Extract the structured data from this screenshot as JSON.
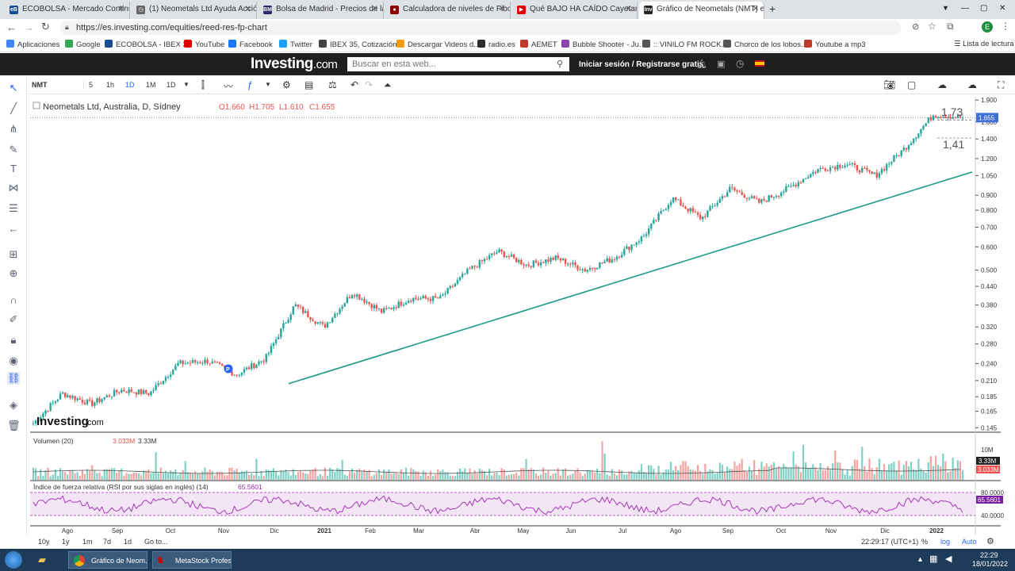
{
  "browser": {
    "tabs": [
      {
        "label": "ECOBOLSA - Mercado Continuo",
        "fav": "eB",
        "color": "#1a4d8f"
      },
      {
        "label": "(1) Neometals Ltd Ayuda Acción",
        "fav": "◷",
        "color": "#666666"
      },
      {
        "label": "Bolsa de Madrid - Precios de la s",
        "fav": "BM",
        "color": "#2a2a6a"
      },
      {
        "label": "Calculadora de niveles de Fibona",
        "fav": "●",
        "color": "#8b0000"
      },
      {
        "label": "Qué BAJO HA CAÍDO Cayetana c",
        "fav": "▶",
        "color": "#e00000"
      },
      {
        "label": "Gráfico de Neometals (NMT) en",
        "fav": "Inv",
        "color": "#222222"
      }
    ],
    "new_tab": "+",
    "url": "https://es.investing.com/equities/reed-res-fp-chart",
    "bookmarks": [
      {
        "label": "Aplicaciones",
        "color": "#4285f4"
      },
      {
        "label": "Google",
        "color": "#34a853"
      },
      {
        "label": "ECOBOLSA - IBEX 35",
        "color": "#1a4d8f"
      },
      {
        "label": "YouTube",
        "color": "#e00000"
      },
      {
        "label": "Facebook",
        "color": "#1877f2"
      },
      {
        "label": "Twitter",
        "color": "#1da1f2"
      },
      {
        "label": "IBEX 35, Cotización...",
        "color": "#444444"
      },
      {
        "label": "Descargar Videos d...",
        "color": "#f39c12"
      },
      {
        "label": "radio.es",
        "color": "#2d2d2d"
      },
      {
        "label": "AEMET",
        "color": "#c0392b"
      },
      {
        "label": "Bubble Shooter - Ju...",
        "color": "#8e44ad"
      },
      {
        "label": ":: VINILO FM ROCK...",
        "color": "#555555"
      },
      {
        "label": "Chorco de los lobos...",
        "color": "#555555"
      },
      {
        "label": "Youtube a mp3",
        "color": "#c0392b"
      }
    ],
    "reading_list": "Lista de lectura",
    "profile_initial": "E"
  },
  "site": {
    "logo": "Investing",
    "logo_suffix": ".com",
    "search_placeholder": "Buscar en esta web...",
    "login": "Iniciar sesión / Registrarse gratis"
  },
  "toolbar": {
    "symbol": "NMT",
    "intervals": [
      "5",
      "1h",
      "1D",
      "1M",
      "1D"
    ],
    "active_interval": "1D"
  },
  "legend": {
    "title": "Neometals Ltd, Australia, D, Sídney",
    "o": "O1.660",
    "h": "H1.705",
    "l": "L1.610",
    "c": "C1.655"
  },
  "volume_legend": {
    "title": "Volumen (20)",
    "v1": "3.033M",
    "v2": "3.33M"
  },
  "rsi_legend": {
    "title": "Índice de fuerza relativa (RSI por sus siglas en inglés) (14)",
    "value": "65.5601"
  },
  "watermark": {
    "logo": "Investing",
    "suffix": ".com"
  },
  "chart_data": {
    "type": "candlestick",
    "title": "Neometals Ltd, Australia, D, Sídney",
    "scale": "log",
    "ylim": [
      0.14,
      1.95
    ],
    "y_ticks": [
      "1.900",
      "1.600",
      "1.400",
      "1.200",
      "1.050",
      "0.900",
      "0.800",
      "0.700",
      "0.600",
      "0.500",
      "0.440",
      "0.380",
      "0.320",
      "0.280",
      "0.240",
      "0.210",
      "0.185",
      "0.165",
      "0.145"
    ],
    "x_ticks": [
      "Ago",
      "Sep",
      "Oct",
      "Nov",
      "Dic",
      "2021",
      "Feb",
      "Mar",
      "Abr",
      "May",
      "Jun",
      "Jul",
      "Ago",
      "Sep",
      "Oct",
      "Nov",
      "Dic",
      "2022"
    ],
    "price_path": [
      {
        "date": "Jul 2020",
        "close": 0.15
      },
      {
        "date": "Ago 2020",
        "close": 0.19
      },
      {
        "date": "Sep 2020",
        "close": 0.175
      },
      {
        "date": "Oct 2020",
        "close": 0.195
      },
      {
        "date": "Nov 2020",
        "close": 0.19
      },
      {
        "date": "Nov 2020",
        "close": 0.24
      },
      {
        "date": "Dic 2020",
        "close": 0.245
      },
      {
        "date": "Dic 2020",
        "close": 0.22
      },
      {
        "date": "2021",
        "close": 0.25
      },
      {
        "date": "Ene 2021",
        "close": 0.38
      },
      {
        "date": "Feb 2021",
        "close": 0.32
      },
      {
        "date": "Feb 2021",
        "close": 0.42
      },
      {
        "date": "Mar 2021",
        "close": 0.36
      },
      {
        "date": "Mar 2021",
        "close": 0.4
      },
      {
        "date": "Abr 2021",
        "close": 0.4
      },
      {
        "date": "Abr 2021",
        "close": 0.5
      },
      {
        "date": "May 2021",
        "close": 0.58
      },
      {
        "date": "May 2021",
        "close": 0.52
      },
      {
        "date": "Jun 2021",
        "close": 0.55
      },
      {
        "date": "Jul 2021",
        "close": 0.5
      },
      {
        "date": "Jul 2021",
        "close": 0.55
      },
      {
        "date": "Ago 2021",
        "close": 0.65
      },
      {
        "date": "Ago 2021",
        "close": 0.88
      },
      {
        "date": "Sep 2021",
        "close": 0.75
      },
      {
        "date": "Sep 2021",
        "close": 0.95
      },
      {
        "date": "Oct 2021",
        "close": 0.85
      },
      {
        "date": "Oct 2021",
        "close": 0.95
      },
      {
        "date": "Nov 2021",
        "close": 1.1
      },
      {
        "date": "Dic 2021",
        "close": 1.15
      },
      {
        "date": "Dic 2021",
        "close": 1.05
      },
      {
        "date": "2022",
        "close": 1.3
      },
      {
        "date": "2022",
        "close": 1.7
      },
      {
        "date": "Ene 2022",
        "close": 1.655
      }
    ],
    "trendline": {
      "from": {
        "date": "Dic 2020",
        "value": 0.205
      },
      "to": {
        "date": "Ene 2022",
        "value": 1.08
      }
    },
    "current_price_label": "1.655",
    "annotations": [
      "1,73",
      "1,41"
    ],
    "volume": {
      "labels": [
        "10M",
        "3.33M",
        "3.033M"
      ],
      "current": "3.033M"
    },
    "rsi": {
      "value": "65.5601",
      "levels": [
        "80.0000",
        "40.0000"
      ]
    },
    "colors": {
      "up": "#26a69a",
      "down": "#ef5350",
      "trendline": "#1a9a82",
      "rsi": "#9c27b0",
      "rsi_band": "#f3e5f5",
      "price_label": "#3f6fd9"
    }
  },
  "bottom": {
    "ranges": [
      "10y",
      "1y",
      "1m",
      "7d",
      "1d"
    ],
    "goto": "Go to...",
    "clock": "22:29:17 (UTC+1)",
    "pct": "%",
    "log": "log",
    "auto": "Auto"
  },
  "taskbar": {
    "items": [
      "Gráfico de Neom...",
      "MetaStock Profes..."
    ],
    "time": "22:29",
    "date": "18/01/2022"
  }
}
